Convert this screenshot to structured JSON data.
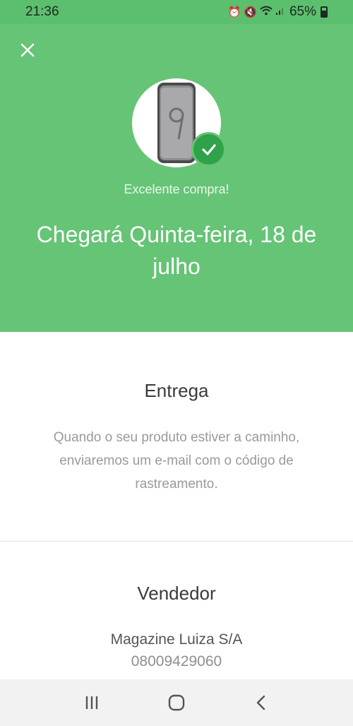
{
  "status_bar": {
    "time": "21:36",
    "battery": "65%",
    "icons": [
      "alarm-icon",
      "mute-icon",
      "wifi-icon",
      "signal-icon",
      "battery-icon"
    ]
  },
  "header": {
    "close_icon": "close-icon",
    "product_image": "phone-image",
    "badge_icon": "check-icon",
    "subtitle": "Excelente compra!",
    "headline": "Chegará Quinta-feira, 18 de julho",
    "colors": {
      "background": "#66c476",
      "badge": "#2fa24a",
      "text": "#ffffff"
    }
  },
  "delivery": {
    "title": "Entrega",
    "description": "Quando o seu produto estiver a caminho, enviaremos um e-mail com o código de rastreamento."
  },
  "seller": {
    "title": "Vendedor",
    "name": "Magazine Luiza S/A",
    "phone": "08009429060"
  },
  "nav_bar": {
    "buttons": [
      "recent-apps-icon",
      "home-icon",
      "back-icon"
    ]
  }
}
